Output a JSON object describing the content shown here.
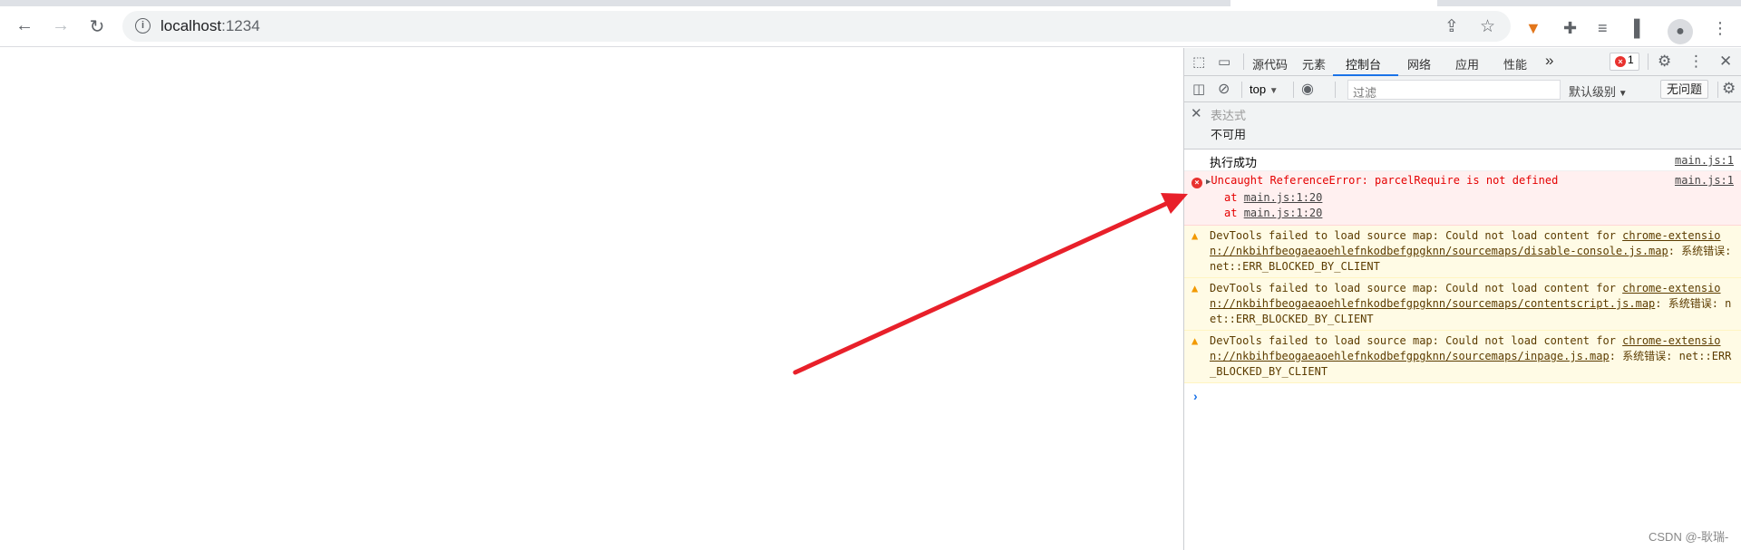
{
  "browser": {
    "url_host": "localhost",
    "url_port": ":1234"
  },
  "devtools": {
    "tabs": [
      {
        "label": "源代码"
      },
      {
        "label": "元素"
      },
      {
        "label": "控制台"
      },
      {
        "label": "网络"
      },
      {
        "label": "应用"
      },
      {
        "label": "性能"
      }
    ],
    "active_tab": "控制台",
    "more": "»",
    "error_count": "1",
    "context": "top",
    "filter_placeholder": "过滤",
    "level": "默认级别",
    "issues": "无问题",
    "expression": {
      "label": "表达式",
      "value": "不可用"
    },
    "messages": {
      "log": {
        "text": "执行成功",
        "source": "main.js:1"
      },
      "error": {
        "text": "Uncaught ReferenceError: parcelRequire is not defined",
        "source": "main.js:1",
        "stack": [
          {
            "at": "at",
            "loc": "main.js:1:20"
          },
          {
            "at": "at",
            "loc": "main.js:1:20"
          }
        ]
      },
      "warnings": [
        {
          "prefix": "DevTools failed to load source map: Could not load content for ",
          "link": "chrome-extension://nkbihfbeogaeaoehlefnkodbefgpgknn/sourcemaps/disable-console.js.map",
          "suffix": ": 系统错误: net::ERR_BLOCKED_BY_CLIENT"
        },
        {
          "prefix": "DevTools failed to load source map: Could not load content for ",
          "link": "chrome-extension://nkbihfbeogaeaoehlefnkodbefgpgknn/sourcemaps/contentscript.js.map",
          "suffix": ": 系统错误: net::ERR_BLOCKED_BY_CLIENT"
        },
        {
          "prefix": "DevTools failed to load source map: Could not load content for ",
          "link": "chrome-extension://nkbihfbeogaeaoehlefnkodbefgpgknn/sourcemaps/inpage.js.map",
          "suffix": ": 系统错误: net::ERR_BLOCKED_BY_CLIENT"
        }
      ]
    }
  },
  "annotation_color": "#e8202a",
  "watermark": "CSDN @-耿瑞-"
}
